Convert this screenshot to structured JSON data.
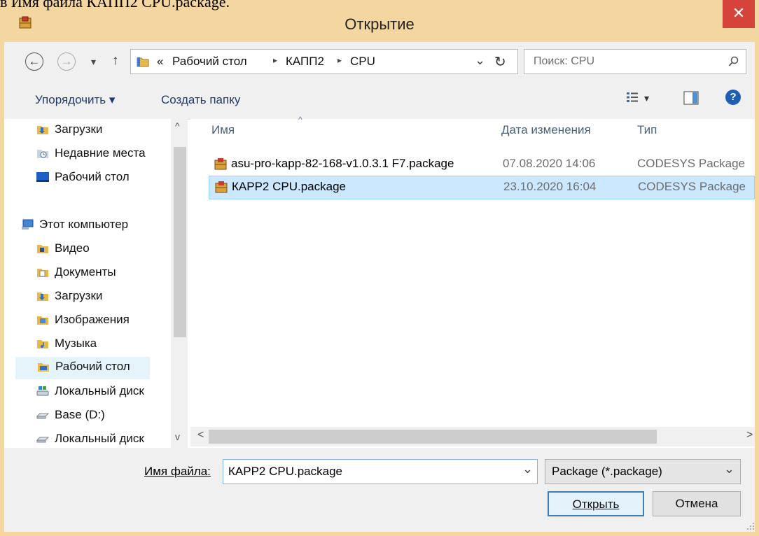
{
  "document": {
    "caption": "в Имя файла КАПП2 CPU.package."
  },
  "window": {
    "title": "Открытие",
    "close": "✕"
  },
  "address": {
    "back": "←",
    "forward": "→",
    "recent": "▾",
    "up": "↑",
    "overflow": "«",
    "crumbs": [
      "Рабочий стол",
      "КАПП2",
      "CPU"
    ],
    "separator": "▸",
    "dropdown": "⌄",
    "refresh": "↻",
    "search_placeholder": "Поиск: CPU",
    "search_icon": "⌕"
  },
  "toolbar": {
    "organize": "Упорядочить ▾",
    "new_folder": "Создать папку",
    "view_arrow": "▾",
    "help": "?"
  },
  "nav": {
    "items": [
      {
        "label": "Загрузки",
        "icon": "downloads-folder-icon"
      },
      {
        "label": "Недавние места",
        "icon": "recent-places-icon"
      },
      {
        "label": "Рабочий стол",
        "icon": "desktop-icon"
      },
      {
        "label": "Этот компьютер",
        "icon": "computer-icon"
      },
      {
        "label": "Видео",
        "icon": "videos-folder-icon"
      },
      {
        "label": "Документы",
        "icon": "documents-folder-icon"
      },
      {
        "label": "Загрузки",
        "icon": "downloads-folder-icon"
      },
      {
        "label": "Изображения",
        "icon": "pictures-folder-icon"
      },
      {
        "label": "Музыка",
        "icon": "music-folder-icon"
      },
      {
        "label": "Рабочий стол",
        "icon": "desktop-folder-icon"
      },
      {
        "label": "Локальный диск",
        "icon": "local-disk-icon"
      },
      {
        "label": "Base (D:)",
        "icon": "drive-icon"
      },
      {
        "label": "Локальный диск",
        "icon": "drive-icon"
      }
    ],
    "scroll_up": "^",
    "scroll_down": "v"
  },
  "files": {
    "columns": {
      "name": "Имя",
      "date": "Дата изменения",
      "type": "Тип"
    },
    "sort_indicator": "^",
    "rows": [
      {
        "name": "asu-pro-kapp-82-168-v1.0.3.1 F7.package",
        "date": "07.08.2020 14:06",
        "type": "CODESYS Package"
      },
      {
        "name": "КАРР2 CPU.package",
        "date": "23.10.2020 16:04",
        "type": "CODESYS Package"
      }
    ],
    "scroll_left": "<",
    "scroll_right": ">"
  },
  "bottom": {
    "filename_label": "Имя файла:",
    "filename_value": "КАРР2 CPU.package",
    "filename_dropdown": "⌄",
    "filter_value": "Package (*.package)",
    "filter_dropdown": "⌄",
    "open": "Открыть",
    "cancel": "Отмена"
  },
  "colors": {
    "frame": "#f4d6a0",
    "close": "#d6433a",
    "selection": "#cce8ff",
    "accent": "#1e3b6b"
  }
}
